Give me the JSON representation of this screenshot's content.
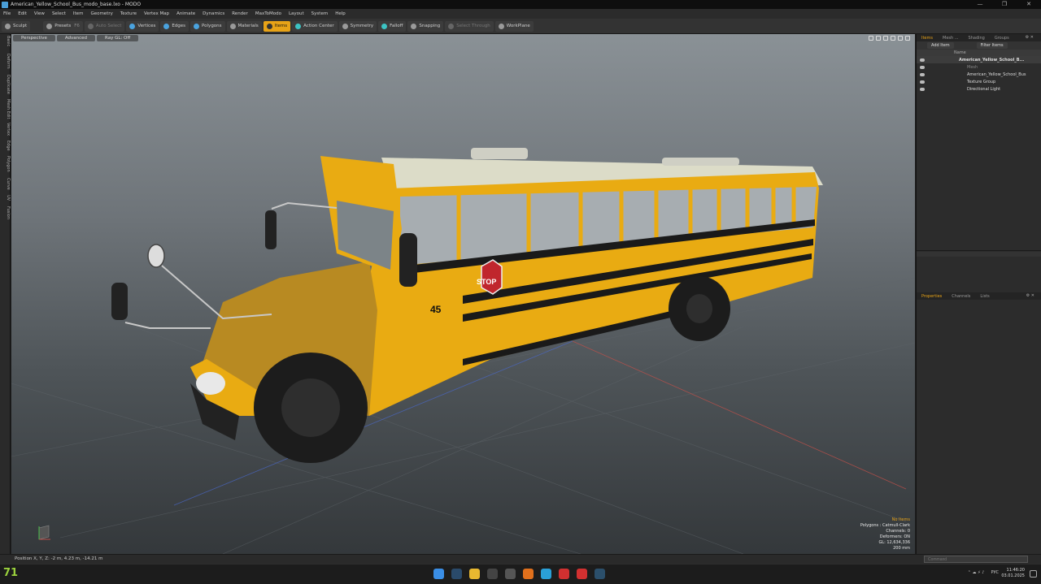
{
  "window": {
    "title": "American_Yellow_School_Bus_modo_base.lxo - MODO",
    "controls": [
      "—",
      "❐",
      "✕"
    ]
  },
  "menu": [
    "File",
    "Edit",
    "View",
    "Select",
    "Item",
    "Geometry",
    "Texture",
    "Vertex Map",
    "Animate",
    "Dynamics",
    "Render",
    "MaxToModo",
    "Layout",
    "System",
    "Help"
  ],
  "toolbar": {
    "sculpt": "Sculpt",
    "presets": "Presets",
    "presets_key": "F6",
    "auto_select": "Auto Select",
    "vertices": "Vertices",
    "edges": "Edges",
    "polygons": "Polygons",
    "materials": "Materials",
    "items": "Items",
    "action_center": "Action Center",
    "symmetry": "Symmetry",
    "falloff": "Falloff",
    "snapping": "Snapping",
    "select_through": "Select Through",
    "workplane": "WorkPlane"
  },
  "left_tabs": [
    "Basic",
    "Deform",
    "Duplicate",
    "Mesh Edit",
    "Vertex",
    "Edge",
    "Polygon",
    "Curve",
    "UV",
    "Fusion"
  ],
  "viewport": {
    "view": "Perspective",
    "shading": "Advanced",
    "ray_gl": "Ray GL: Off",
    "bus_number": "45",
    "stop_sign": "STOP",
    "info": {
      "selection": "No Items",
      "polygons": "Polygons : Catmull-Clark",
      "channels": "Channels: 0",
      "deformers": "Deformers: ON",
      "gl": "GL: 12,634,336",
      "scale": "200 mm"
    }
  },
  "status": {
    "position": "Position X, Y, Z:   -2 m, 4.23 m, -14.21 m",
    "command_placeholder": "Command"
  },
  "right_panel": {
    "top_tabs": [
      "Items",
      "Mesh ...",
      "Shading",
      "Groups"
    ],
    "add_item": "Add Item",
    "filter_items": "Filter Items",
    "name_col": "Name",
    "tree": [
      {
        "label": "American_Yellow_School_B...",
        "indent": 0
      },
      {
        "label": "Mesh",
        "indent": 2
      },
      {
        "label": "American_Yellow_School_Bus",
        "indent": 2
      },
      {
        "label": "Texture Group",
        "indent": 2
      },
      {
        "label": "Directional Light",
        "indent": 2
      }
    ],
    "bottom_tabs": [
      "Properties",
      "Channels",
      "Lists"
    ]
  },
  "taskbar": {
    "temperature": "71",
    "lang": "РУС",
    "time": "11:46:20",
    "date": "03.01.2025"
  },
  "colors": {
    "accent": "#e8a317",
    "bus_yellow": "#e9ab12",
    "stop_red": "#c0262d"
  }
}
